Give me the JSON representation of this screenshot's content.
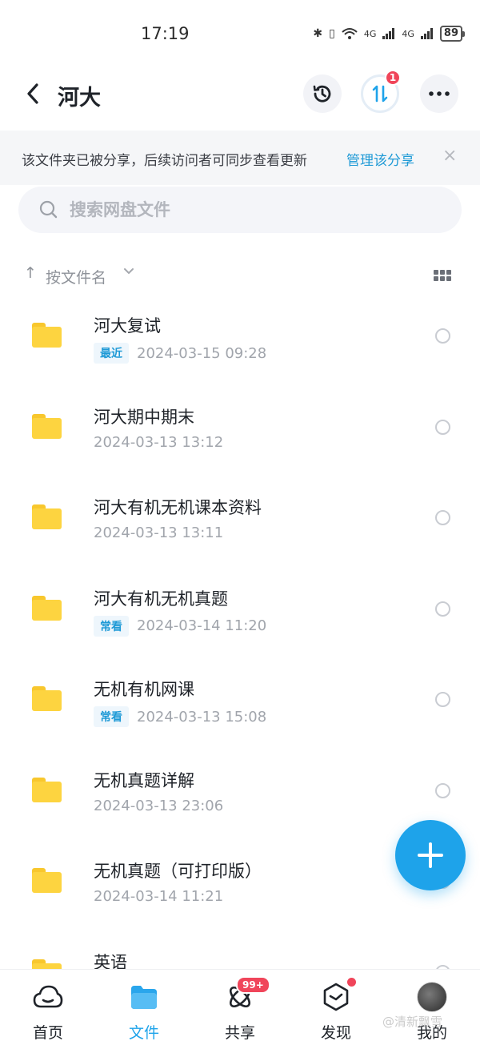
{
  "status_bar": {
    "time": "17:19",
    "signal1": "4G",
    "signal2": "4G",
    "battery": "89"
  },
  "header": {
    "title": "河大",
    "transfer_badge": "1"
  },
  "share_notice": {
    "text": "该文件夹已被分享，后续访问者可同步查看更新",
    "link": "管理该分享",
    "close": "×"
  },
  "search": {
    "placeholder": "搜索网盘文件"
  },
  "sort": {
    "label": "按文件名"
  },
  "files": [
    {
      "name": "河大复试",
      "tag": "最近",
      "date": "2024-03-15  09:28"
    },
    {
      "name": "河大期中期末",
      "tag": "",
      "date": "2024-03-13  13:12"
    },
    {
      "name": "河大有机无机课本资料",
      "tag": "",
      "date": "2024-03-13  13:11"
    },
    {
      "name": "河大有机无机真题",
      "tag": "常看",
      "date": "2024-03-14  11:20"
    },
    {
      "name": "无机有机网课",
      "tag": "常看",
      "date": "2024-03-13  15:08"
    },
    {
      "name": "无机真题详解",
      "tag": "",
      "date": "2024-03-13  23:06"
    },
    {
      "name": "无机真题（可打印版）",
      "tag": "",
      "date": "2024-03-14  11:21"
    },
    {
      "name": "英语",
      "tag": "",
      "date": ""
    }
  ],
  "bottom_nav": {
    "items": [
      {
        "label": "首页",
        "icon": "cloud-icon"
      },
      {
        "label": "文件",
        "icon": "folder-icon"
      },
      {
        "label": "共享",
        "icon": "atom-icon",
        "badge": "99+"
      },
      {
        "label": "发现",
        "icon": "cube-icon"
      },
      {
        "label": "我的",
        "icon": "avatar"
      }
    ],
    "active": 1
  },
  "watermark": "@清新飘雪",
  "colors": {
    "accent": "#1ea3ea",
    "link": "#1f9ad6",
    "badge": "#f0455a",
    "folder": "#fdd440"
  }
}
